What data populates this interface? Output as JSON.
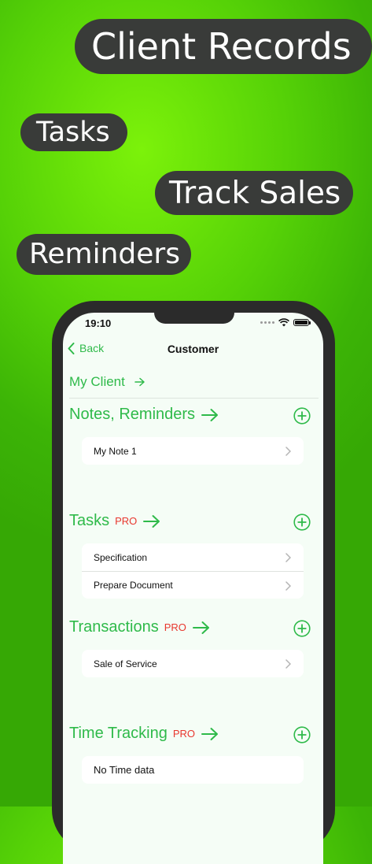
{
  "promo": {
    "title": "Client Records",
    "tasks": "Tasks",
    "sales": "Track Sales",
    "reminders": "Reminders"
  },
  "status_bar": {
    "time": "19:10"
  },
  "nav": {
    "back_label": "Back",
    "title": "Customer"
  },
  "client": {
    "name": "My Client"
  },
  "sections": {
    "notes": {
      "title": "Notes, Reminders",
      "items": [
        "My Note 1"
      ]
    },
    "tasks": {
      "title": "Tasks",
      "pro": "PRO",
      "items": [
        "Specification",
        "Prepare Document"
      ]
    },
    "transactions": {
      "title": "Transactions",
      "pro": "PRO",
      "items": [
        "Sale of Service"
      ]
    },
    "time_tracking": {
      "title": "Time Tracking",
      "pro": "PRO",
      "empty_text": "No Time data"
    }
  },
  "colors": {
    "accent": "#2fba4a",
    "pro": "#e8372e",
    "pill": "#393b39"
  }
}
